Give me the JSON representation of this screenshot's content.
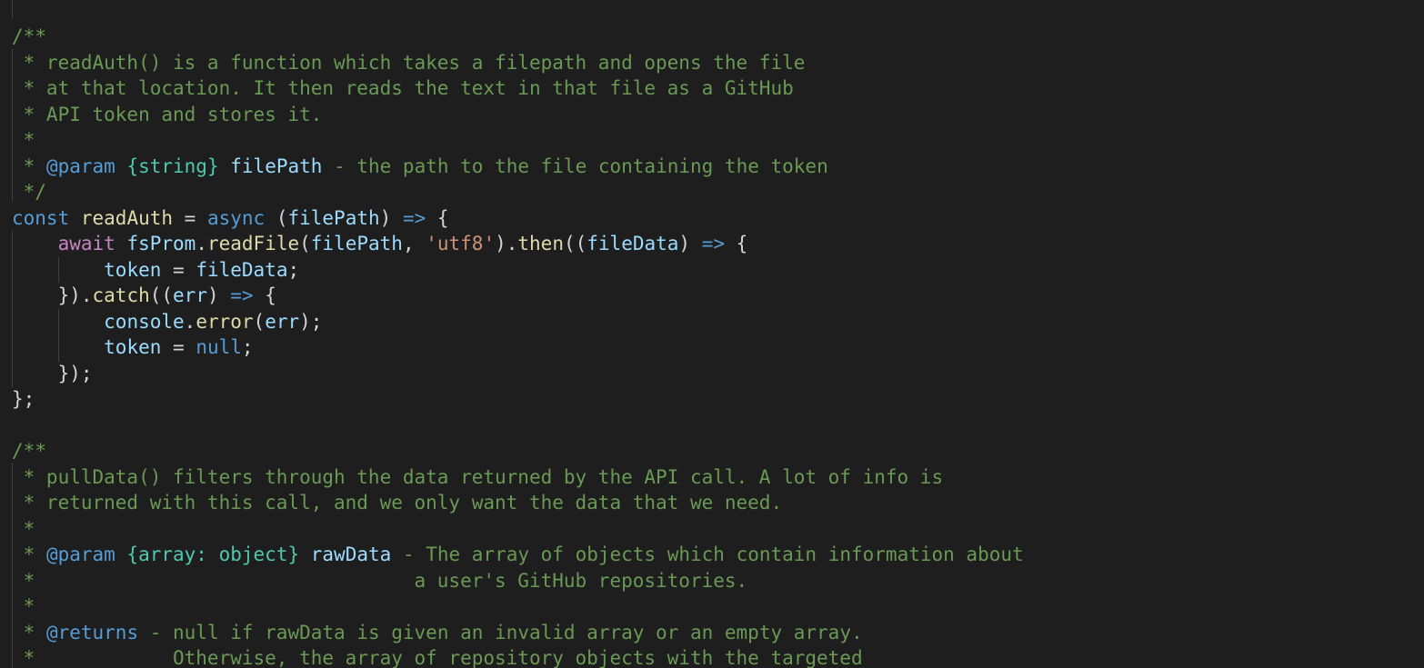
{
  "colors": {
    "background": "#1e1e1e",
    "default": "#d4d4d4",
    "comment": "#6a9955",
    "keyword": "#569cd6",
    "control": "#c586c0",
    "variable": "#9cdcfe",
    "function": "#dcdcaa",
    "string": "#ce9178",
    "type": "#4ec9b0",
    "indent_guide": "#404040"
  },
  "code_lines": [
    [
      [
        "comment",
        "/**"
      ]
    ],
    [
      [
        "comment",
        " * readAuth() is a function which takes a filepath and opens the file"
      ]
    ],
    [
      [
        "comment",
        " * at that location. It then reads the text in that file as a GitHub"
      ]
    ],
    [
      [
        "comment",
        " * API token and stores it."
      ]
    ],
    [
      [
        "comment",
        " *"
      ]
    ],
    [
      [
        "comment",
        " * "
      ],
      [
        "keyword",
        "@param"
      ],
      [
        "comment",
        " "
      ],
      [
        "type",
        "{string}"
      ],
      [
        "comment",
        " "
      ],
      [
        "variable",
        "filePath"
      ],
      [
        "comment",
        " - the path to the file containing the token"
      ]
    ],
    [
      [
        "comment",
        " */"
      ]
    ],
    [
      [
        "keyword",
        "const"
      ],
      [
        "plain",
        " "
      ],
      [
        "function",
        "readAuth"
      ],
      [
        "plain",
        " = "
      ],
      [
        "keyword",
        "async"
      ],
      [
        "plain",
        " ("
      ],
      [
        "variable",
        "filePath"
      ],
      [
        "plain",
        ") "
      ],
      [
        "keyword",
        "=>"
      ],
      [
        "plain",
        " {"
      ]
    ],
    [
      [
        "plain",
        "    "
      ],
      [
        "control",
        "await"
      ],
      [
        "plain",
        " "
      ],
      [
        "variable",
        "fsProm"
      ],
      [
        "plain",
        "."
      ],
      [
        "function",
        "readFile"
      ],
      [
        "plain",
        "("
      ],
      [
        "variable",
        "filePath"
      ],
      [
        "plain",
        ", "
      ],
      [
        "string",
        "'utf8'"
      ],
      [
        "plain",
        ")."
      ],
      [
        "function",
        "then"
      ],
      [
        "plain",
        "(("
      ],
      [
        "variable",
        "fileData"
      ],
      [
        "plain",
        ") "
      ],
      [
        "keyword",
        "=>"
      ],
      [
        "plain",
        " {"
      ]
    ],
    [
      [
        "plain",
        "        "
      ],
      [
        "variable",
        "token"
      ],
      [
        "plain",
        " = "
      ],
      [
        "variable",
        "fileData"
      ],
      [
        "plain",
        ";"
      ]
    ],
    [
      [
        "plain",
        "    })."
      ],
      [
        "function",
        "catch"
      ],
      [
        "plain",
        "(("
      ],
      [
        "variable",
        "err"
      ],
      [
        "plain",
        ") "
      ],
      [
        "keyword",
        "=>"
      ],
      [
        "plain",
        " {"
      ]
    ],
    [
      [
        "plain",
        "        "
      ],
      [
        "variable",
        "console"
      ],
      [
        "plain",
        "."
      ],
      [
        "function",
        "error"
      ],
      [
        "plain",
        "("
      ],
      [
        "variable",
        "err"
      ],
      [
        "plain",
        ");"
      ]
    ],
    [
      [
        "plain",
        "        "
      ],
      [
        "variable",
        "token"
      ],
      [
        "plain",
        " = "
      ],
      [
        "keyword",
        "null"
      ],
      [
        "plain",
        ";"
      ]
    ],
    [
      [
        "plain",
        "    });"
      ]
    ],
    [
      [
        "plain",
        "};"
      ]
    ],
    [],
    [
      [
        "comment",
        "/**"
      ]
    ],
    [
      [
        "comment",
        " * pullData() filters through the data returned by the API call. A lot of info is"
      ]
    ],
    [
      [
        "comment",
        " * returned with this call, and we only want the data that we need."
      ]
    ],
    [
      [
        "comment",
        " *"
      ]
    ],
    [
      [
        "comment",
        " * "
      ],
      [
        "keyword",
        "@param"
      ],
      [
        "comment",
        " "
      ],
      [
        "type",
        "{array: object}"
      ],
      [
        "comment",
        " "
      ],
      [
        "variable",
        "rawData"
      ],
      [
        "comment",
        " - The array of objects which contain information about"
      ]
    ],
    [
      [
        "comment",
        " *                                 a user's GitHub repositories."
      ]
    ],
    [
      [
        "comment",
        " *"
      ]
    ],
    [
      [
        "comment",
        " * "
      ],
      [
        "keyword",
        "@returns"
      ],
      [
        "comment",
        " - null if rawData is given an invalid array or an empty array."
      ]
    ],
    [
      [
        "comment",
        " *            Otherwise, the array of repository objects with the targeted"
      ]
    ]
  ]
}
